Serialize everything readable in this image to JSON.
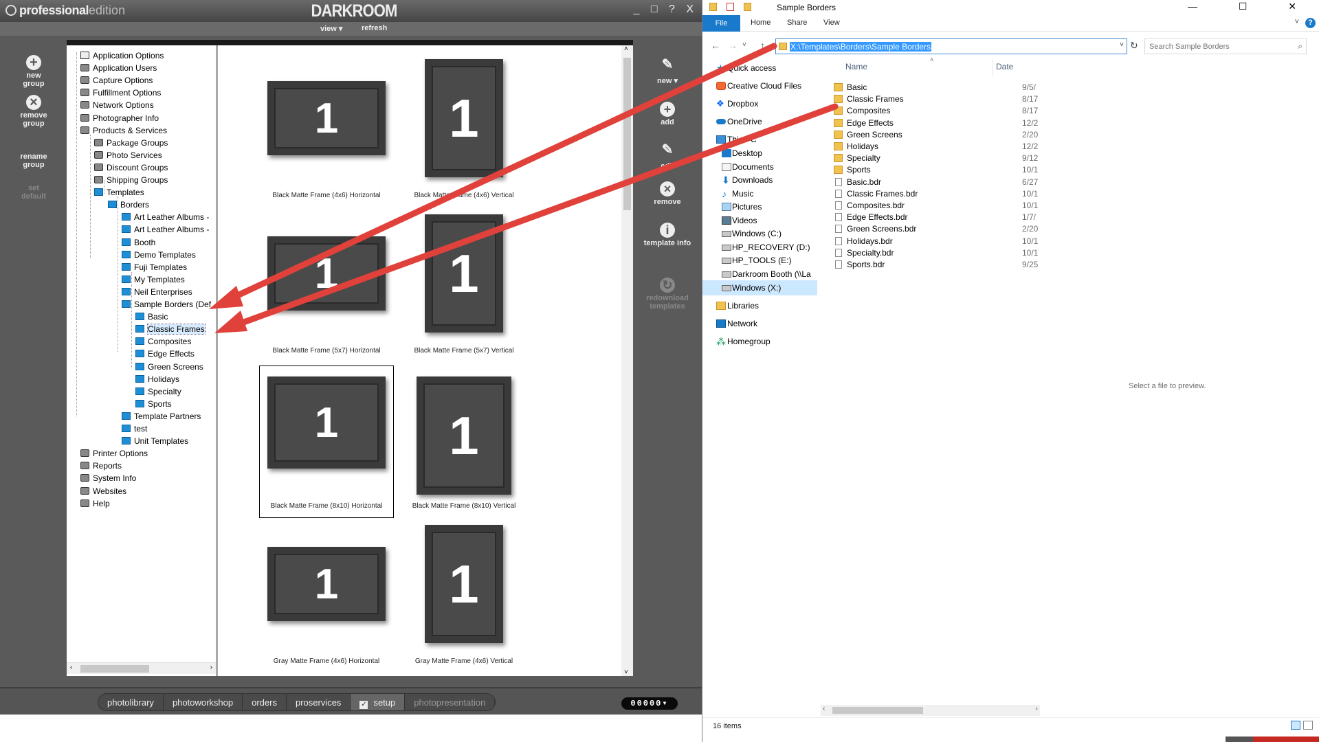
{
  "darkroom": {
    "logo_bold": "professional",
    "logo_light": "edition",
    "brand": "DARKROOM",
    "window_controls": "_ □ ? X",
    "menu": {
      "view": "view ▾",
      "refresh": "refresh"
    },
    "left_buttons": [
      {
        "label": "new group",
        "icon": "+"
      },
      {
        "label": "remove group",
        "icon": "×"
      },
      {
        "label": "rename group",
        "icon": ""
      },
      {
        "label": "set default",
        "icon": ""
      }
    ],
    "tree": [
      {
        "label": "Application Options",
        "level": 0,
        "icon": "opt"
      },
      {
        "label": "Application Users",
        "level": 0,
        "icon": "gen"
      },
      {
        "label": "Capture Options",
        "level": 0,
        "icon": "gen"
      },
      {
        "label": "Fulfillment Options",
        "level": 0,
        "icon": "gen"
      },
      {
        "label": "Network Options",
        "level": 0,
        "icon": "gen"
      },
      {
        "label": "Photographer Info",
        "level": 0,
        "icon": "gen"
      },
      {
        "label": "Products & Services",
        "level": 0,
        "icon": "gen"
      },
      {
        "label": "Package Groups",
        "level": 1,
        "icon": "gen"
      },
      {
        "label": "Photo Services",
        "level": 1,
        "icon": "gen"
      },
      {
        "label": "Discount Groups",
        "level": 1,
        "icon": "gen"
      },
      {
        "label": "Shipping Groups",
        "level": 1,
        "icon": "gen"
      },
      {
        "label": "Templates",
        "level": 1,
        "icon": "tmpl"
      },
      {
        "label": "Borders",
        "level": 2,
        "icon": "tmpl"
      },
      {
        "label": "Art Leather Albums -",
        "level": 3,
        "icon": "tmpl"
      },
      {
        "label": "Art Leather Albums -",
        "level": 3,
        "icon": "tmpl"
      },
      {
        "label": "Booth",
        "level": 3,
        "icon": "tmpl"
      },
      {
        "label": "Demo Templates",
        "level": 3,
        "icon": "tmpl"
      },
      {
        "label": "Fuji Templates",
        "level": 3,
        "icon": "tmpl"
      },
      {
        "label": "My Templates",
        "level": 3,
        "icon": "tmpl"
      },
      {
        "label": "Neil Enterprises",
        "level": 3,
        "icon": "tmpl"
      },
      {
        "label": "Sample Borders (Def",
        "level": 3,
        "icon": "tmpl"
      },
      {
        "label": "Basic",
        "level": 4,
        "icon": "tmpl"
      },
      {
        "label": "Classic Frames",
        "level": 4,
        "icon": "tmpl",
        "selected": true
      },
      {
        "label": "Composites",
        "level": 4,
        "icon": "tmpl"
      },
      {
        "label": "Edge Effects",
        "level": 4,
        "icon": "tmpl"
      },
      {
        "label": "Green Screens",
        "level": 4,
        "icon": "tmpl"
      },
      {
        "label": "Holidays",
        "level": 4,
        "icon": "tmpl"
      },
      {
        "label": "Specialty",
        "level": 4,
        "icon": "tmpl"
      },
      {
        "label": "Sports",
        "level": 4,
        "icon": "tmpl"
      },
      {
        "label": "Template Partners",
        "level": 3,
        "icon": "tmpl"
      },
      {
        "label": "test",
        "level": 3,
        "icon": "tmpl"
      },
      {
        "label": "Unit Templates",
        "level": 3,
        "icon": "tmpl"
      },
      {
        "label": "Printer Options",
        "level": 0,
        "icon": "gen"
      },
      {
        "label": "Reports",
        "level": 0,
        "icon": "gen"
      },
      {
        "label": "System Info",
        "level": 0,
        "icon": "gen"
      },
      {
        "label": "Websites",
        "level": 0,
        "icon": "gen"
      },
      {
        "label": "Help",
        "level": 0,
        "icon": "gen"
      }
    ],
    "thumbnails": [
      {
        "caption": "Black Matte Frame (4x6) Horizontal",
        "numeral": "1",
        "orientation": "h"
      },
      {
        "caption": "Black Matte Frame (4x6) Vertical",
        "numeral": "1",
        "orientation": "v"
      },
      {
        "caption": "Black Matte Frame (5x7) Horizontal",
        "numeral": "1",
        "orientation": "h"
      },
      {
        "caption": "Black Matte Frame (5x7) Vertical",
        "numeral": "1",
        "orientation": "v"
      },
      {
        "caption": "Black Matte Frame (8x10) Horizontal",
        "numeral": "1",
        "orientation": "h",
        "selected": true
      },
      {
        "caption": "Black Matte Frame (8x10) Vertical",
        "numeral": "1",
        "orientation": "v"
      },
      {
        "caption": "Gray Matte Frame (4x6) Horizontal",
        "numeral": "1",
        "orientation": "h"
      },
      {
        "caption": "Gray Matte Frame (4x6) Vertical",
        "numeral": "1",
        "orientation": "v"
      }
    ],
    "right_buttons": [
      {
        "label": "new ▾",
        "icon": "✎",
        "enabled": true
      },
      {
        "label": "add",
        "icon": "+",
        "enabled": true
      },
      {
        "label": "edit",
        "icon": "✎",
        "enabled": true
      },
      {
        "label": "remove",
        "icon": "×",
        "enabled": true
      },
      {
        "label": "template info",
        "icon": "i",
        "enabled": true
      },
      {
        "label": "redownload templates",
        "icon": "↻",
        "enabled": false
      }
    ],
    "bottom_tabs": [
      {
        "label": "photolibrary",
        "state": "normal"
      },
      {
        "label": "photoworkshop",
        "state": "normal"
      },
      {
        "label": "orders",
        "state": "normal"
      },
      {
        "label": "proservices",
        "state": "normal"
      },
      {
        "label": "setup",
        "state": "active"
      },
      {
        "label": "photopresentation",
        "state": "disabled"
      }
    ],
    "counter": "00000▾"
  },
  "explorer": {
    "title": "Sample Borders",
    "window_controls": "— ☐ ✕",
    "ribbon_tabs": [
      "File",
      "Home",
      "Share",
      "View"
    ],
    "help": "?",
    "address": "X:\\Templates\\Borders\\Sample Borders",
    "search_placeholder": "Search Sample Borders",
    "nav": [
      {
        "label": "Quick access",
        "icon": "star",
        "indent": 0
      },
      {
        "label": "Creative Cloud Files",
        "icon": "cc",
        "indent": 0
      },
      {
        "label": "Dropbox",
        "icon": "dbx",
        "indent": 0
      },
      {
        "label": "OneDrive",
        "icon": "od",
        "indent": 0
      },
      {
        "label": "This PC",
        "icon": "pc",
        "indent": 0
      },
      {
        "label": "Desktop",
        "icon": "desk",
        "indent": 1
      },
      {
        "label": "Documents",
        "icon": "doc",
        "indent": 1
      },
      {
        "label": "Downloads",
        "icon": "dl",
        "indent": 1
      },
      {
        "label": "Music",
        "icon": "mus",
        "indent": 1
      },
      {
        "label": "Pictures",
        "icon": "pic",
        "indent": 1
      },
      {
        "label": "Videos",
        "icon": "vid",
        "indent": 1
      },
      {
        "label": "Windows  (C:)",
        "icon": "drv",
        "indent": 1
      },
      {
        "label": "HP_RECOVERY (D:)",
        "icon": "drv",
        "indent": 1
      },
      {
        "label": "HP_TOOLS (E:)",
        "icon": "drv",
        "indent": 1
      },
      {
        "label": "Darkroom Booth (\\\\La",
        "icon": "drv",
        "indent": 1
      },
      {
        "label": "Windows  (X:)",
        "icon": "drv",
        "indent": 1,
        "selected": true
      },
      {
        "label": "Libraries",
        "icon": "lib",
        "indent": 0
      },
      {
        "label": "Network",
        "icon": "net",
        "indent": 0
      },
      {
        "label": "Homegroup",
        "icon": "hg",
        "indent": 0
      }
    ],
    "columns": {
      "name": "Name",
      "date": "Date"
    },
    "files": [
      {
        "name": "Basic",
        "type": "folder",
        "date": "9/5/"
      },
      {
        "name": "Classic Frames",
        "type": "folder",
        "date": "8/17"
      },
      {
        "name": "Composites",
        "type": "folder",
        "date": "8/17"
      },
      {
        "name": "Edge Effects",
        "type": "folder",
        "date": "12/2"
      },
      {
        "name": "Green Screens",
        "type": "folder",
        "date": "2/20"
      },
      {
        "name": "Holidays",
        "type": "folder",
        "date": "12/2"
      },
      {
        "name": "Specialty",
        "type": "folder",
        "date": "9/12"
      },
      {
        "name": "Sports",
        "type": "folder",
        "date": "10/1"
      },
      {
        "name": "Basic.bdr",
        "type": "file",
        "date": "6/27"
      },
      {
        "name": "Classic Frames.bdr",
        "type": "file",
        "date": "10/1"
      },
      {
        "name": "Composites.bdr",
        "type": "file",
        "date": "10/1"
      },
      {
        "name": "Edge Effects.bdr",
        "type": "file",
        "date": "1/7/"
      },
      {
        "name": "Green Screens.bdr",
        "type": "file",
        "date": "2/20"
      },
      {
        "name": "Holidays.bdr",
        "type": "file",
        "date": "10/1"
      },
      {
        "name": "Specialty.bdr",
        "type": "file",
        "date": "10/1"
      },
      {
        "name": "Sports.bdr",
        "type": "file",
        "date": "9/25"
      }
    ],
    "preview_text": "Select a file to preview.",
    "status": "16 items"
  },
  "colors": {
    "accent_blue": "#1979ca",
    "annotation_red": "#e0413a",
    "darkroom_gray": "#5a5a5a"
  }
}
